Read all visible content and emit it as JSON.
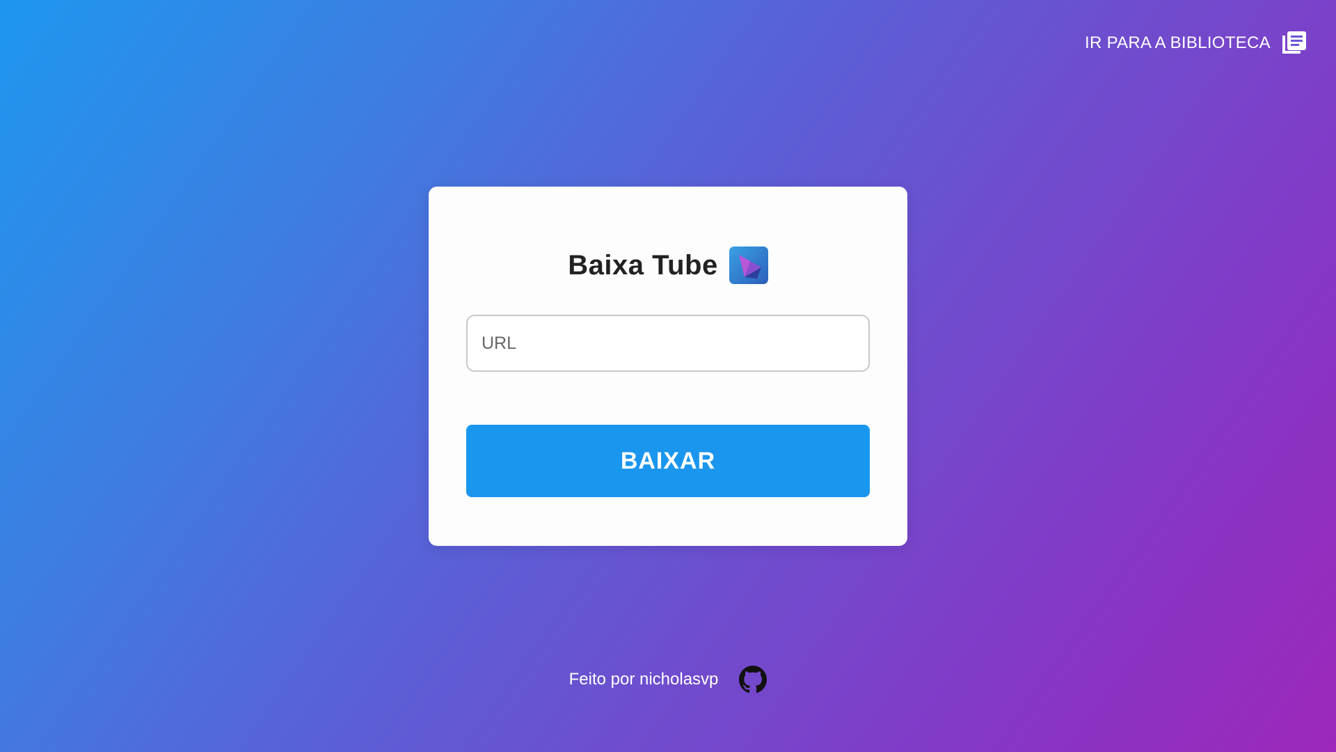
{
  "header": {
    "library_link_label": "IR PARA A BIBLIOTECA",
    "library_icon": "library-books-icon"
  },
  "card": {
    "title": "Baixa Tube",
    "logo_icon": "baixa-tube-logo-icon",
    "url_input": {
      "value": "",
      "placeholder": "URL"
    },
    "download_button_label": "BAIXAR"
  },
  "footer": {
    "credit_text": "Feito por nicholasvp",
    "github_icon": "github-icon"
  },
  "colors": {
    "gradient_start": "#1e97ef",
    "gradient_end": "#9d28ba",
    "card_background": "#fdfdfd",
    "button_background": "#1b96ee",
    "button_text": "#ffffff",
    "title_text": "#222222"
  }
}
